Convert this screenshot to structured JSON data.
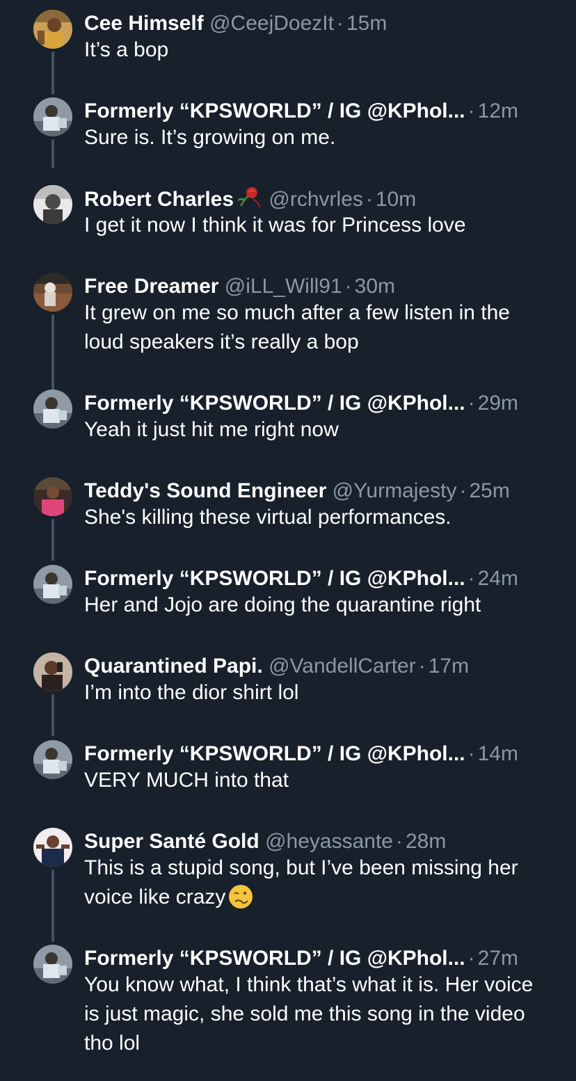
{
  "tweets": [
    {
      "name": "Cee Himself",
      "handle": "@CeejDoezIt",
      "time": "15m",
      "text": "It’s a bop",
      "avatar": "gold"
    },
    {
      "name": "Formerly “KPSWORLD” / IG @KPhol...",
      "handle": "",
      "time": "12m",
      "text": "Sure is. It’s growing on me.",
      "avatar": "kp"
    },
    {
      "name": "Robert Charles",
      "handle": "@rchvrles",
      "time": "10m",
      "text": "I get it now I think it was for Princess love",
      "avatar": "bw",
      "emoji": "rose-icon"
    },
    {
      "name": "Free Dreamer",
      "handle": "@iLL_Will91",
      "time": "30m",
      "text": "It grew on me so much after a few listen in the loud speakers it’s really a bop",
      "avatar": "brown"
    },
    {
      "name": "Formerly “KPSWORLD” / IG @KPhol...",
      "handle": "",
      "time": "29m",
      "text": "Yeah it just hit me right now",
      "avatar": "kp"
    },
    {
      "name": "Teddy's Sound Engineer",
      "handle": "@Yurmajesty",
      "time": "25m",
      "text": "She's killing these virtual performances.",
      "avatar": "pink"
    },
    {
      "name": "Formerly “KPSWORLD” / IG @KPhol...",
      "handle": "",
      "time": "24m",
      "text": "Her and Jojo are doing the quarantine right",
      "avatar": "kp"
    },
    {
      "name": "Quarantined Papi.",
      "handle": "@VandellCarter",
      "time": "17m",
      "text": "I’m into the dior shirt lol",
      "avatar": "mirror"
    },
    {
      "name": "Formerly “KPSWORLD” / IG @KPhol...",
      "handle": "",
      "time": "14m",
      "text": "VERY MUCH into that",
      "avatar": "kp"
    },
    {
      "name": "Super Santé Gold",
      "handle": "@heyassante",
      "time": "28m",
      "text": "This is a stupid song, but I’ve been missing her voice like crazy",
      "avatar": "white",
      "emoji": "woozy-face-icon"
    },
    {
      "name": "Formerly “KPSWORLD” / IG @KPhol...",
      "handle": "",
      "time": "27m",
      "text": "You know what, I think that’s what it is. Her voice is just magic, she sold me this song in the video tho lol",
      "avatar": "kp"
    }
  ],
  "colors": {
    "background": "#17202b",
    "secondary_text": "#8b98a5",
    "thread_line": "#3d5466"
  }
}
